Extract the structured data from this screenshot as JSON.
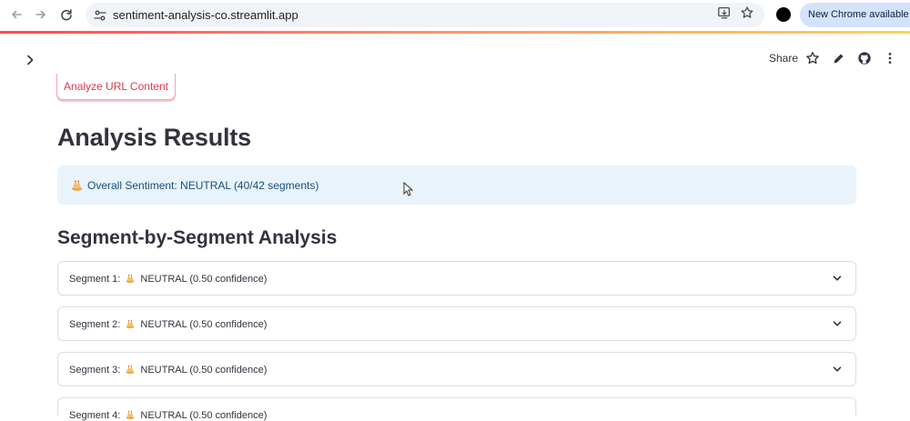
{
  "browser": {
    "url": "sentiment-analysis-co.streamlit.app",
    "update_label": "New Chrome available",
    "icons": [
      "back-icon",
      "forward-icon",
      "reload-icon",
      "site-info-icon",
      "install-app-icon",
      "bookmark-star-icon",
      "profile-icon"
    ]
  },
  "header": {
    "share_label": "Share",
    "icons": [
      "sidebar-expand-icon",
      "star-icon",
      "edit-icon",
      "github-icon",
      "more-vert-icon"
    ]
  },
  "main": {
    "analyze_button_label": "Analyze URL Content",
    "title": "Analysis Results",
    "overall": {
      "icon": "neutral-emoji-icon",
      "text": "Overall Sentiment: NEUTRAL (40/42 segments)"
    },
    "section_title": "Segment-by-Segment Analysis",
    "segments": [
      {
        "prefix": "Segment 1:",
        "text": "NEUTRAL (0.50 confidence)"
      },
      {
        "prefix": "Segment 2:",
        "text": "NEUTRAL (0.50 confidence)"
      },
      {
        "prefix": "Segment 3:",
        "text": "NEUTRAL (0.50 confidence)"
      },
      {
        "prefix": "Segment 4:",
        "text": "NEUTRAL (0.50 confidence)"
      }
    ]
  },
  "colors": {
    "accent_red": "#ff4b4b",
    "info_bg": "#e8f3fb",
    "info_text": "#1a4f7a",
    "text_primary": "#31333f"
  }
}
